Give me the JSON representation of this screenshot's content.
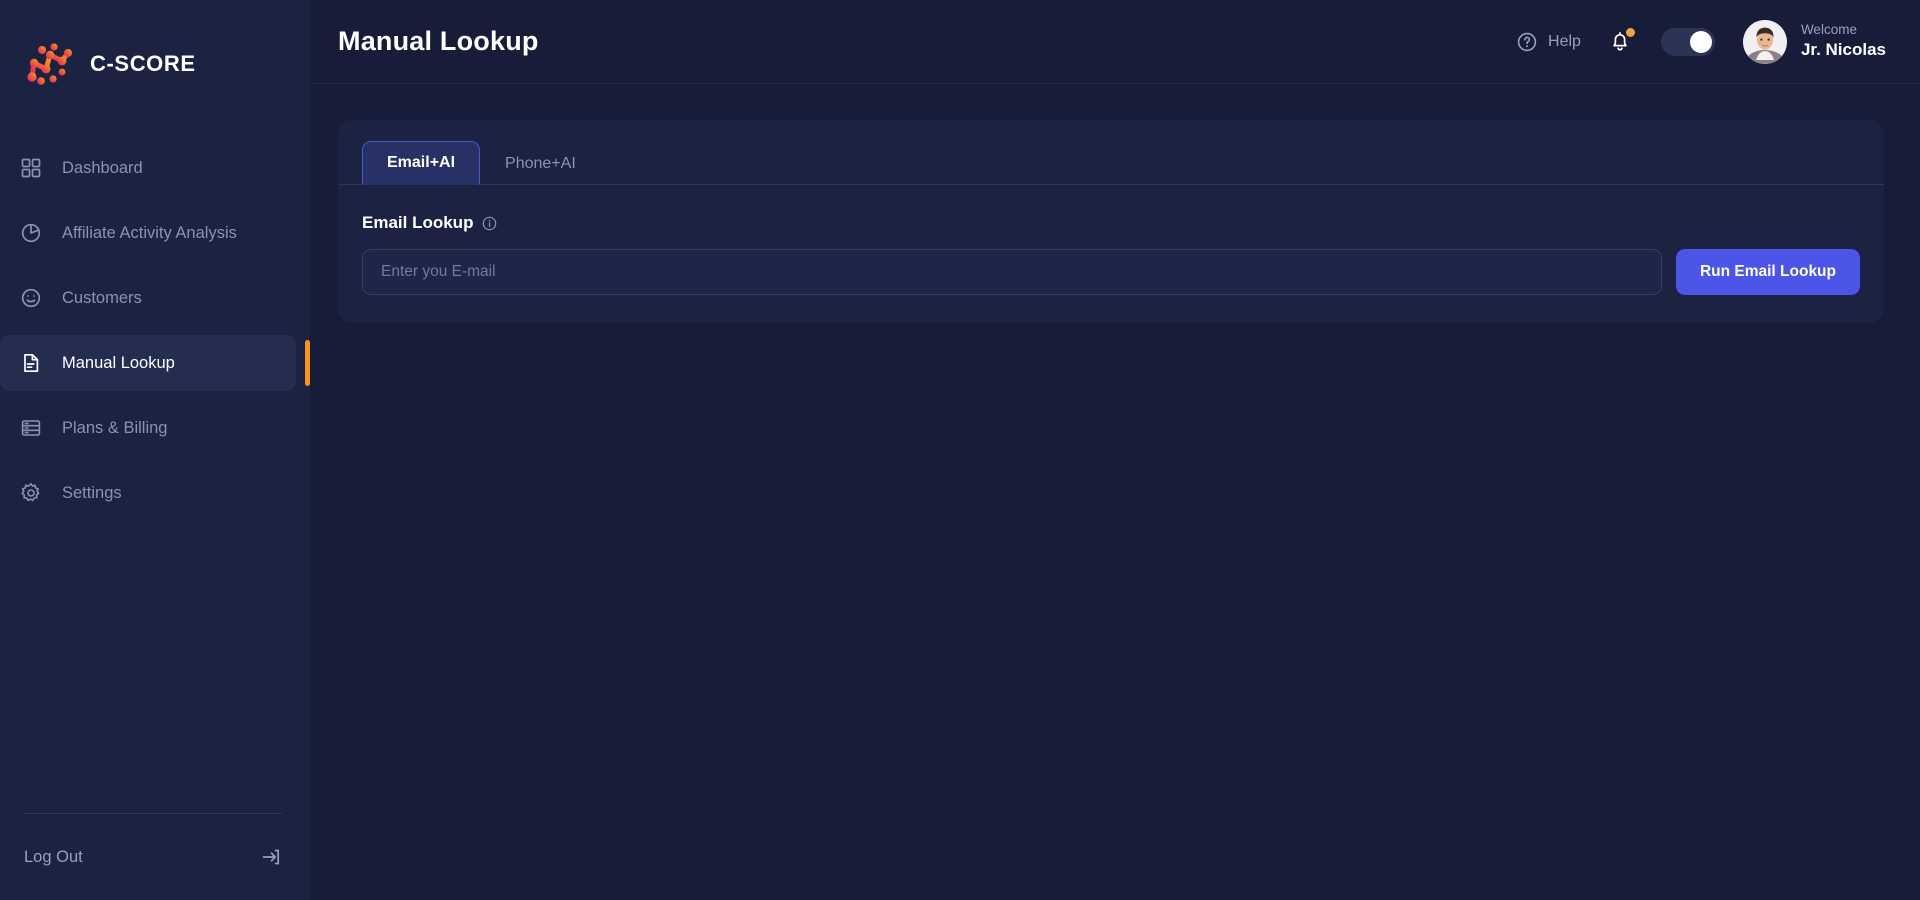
{
  "brand": {
    "name": "C-SCORE",
    "logo_icon": "network-nodes-logo"
  },
  "sidebar": {
    "items": [
      {
        "label": "Dashboard",
        "icon": "grid-icon",
        "active": false
      },
      {
        "label": "Affiliate Activity Analysis",
        "icon": "pie-chart-icon",
        "active": false
      },
      {
        "label": "Customers",
        "icon": "smiley-face-icon",
        "active": false
      },
      {
        "label": "Manual Lookup",
        "icon": "document-icon",
        "active": true
      },
      {
        "label": "Plans & Billing",
        "icon": "billing-card-icon",
        "active": false
      },
      {
        "label": "Settings",
        "icon": "gear-icon",
        "active": false
      }
    ],
    "logout": {
      "label": "Log Out",
      "icon": "logout-arrow-icon"
    },
    "active_accent_color": "#f7931e"
  },
  "header": {
    "title": "Manual Lookup",
    "help_label": "Help",
    "help_icon": "question-circle-icon",
    "notifications_icon": "bell-icon",
    "notifications_has_badge": true,
    "notification_badge_color": "#f2a33c",
    "theme_toggle_on": true,
    "avatar_icon": "user-avatar-photo",
    "welcome_label": "Welcome",
    "user_name": "Jr. Nicolas"
  },
  "main": {
    "tabs": [
      {
        "label": "Email+AI",
        "active": true
      },
      {
        "label": "Phone+AI",
        "active": false
      }
    ],
    "lookup": {
      "field_label": "Email Lookup",
      "info_icon": "info-circle-icon",
      "input_value": "",
      "input_placeholder": "Enter you E-mail",
      "run_button_label": "Run Email Lookup",
      "run_button_color": "#4b55e8"
    }
  }
}
